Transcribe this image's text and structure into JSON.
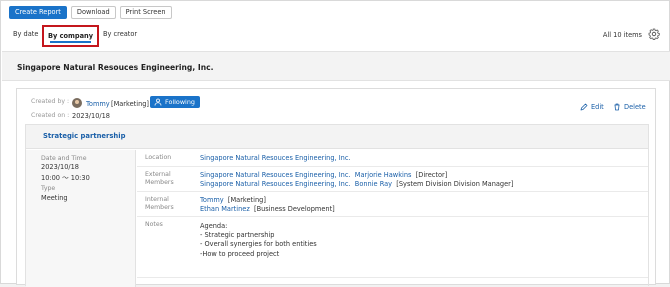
{
  "toolbar": {
    "create_report": "Create Report",
    "download": "Download",
    "print_screen": "Print Screen"
  },
  "tabs": [
    {
      "label": "By date",
      "active": false
    },
    {
      "label": "By company",
      "active": true
    },
    {
      "label": "By creator",
      "active": false
    }
  ],
  "items_count": "All 10 items",
  "company": {
    "name": "Singapore Natural Resouces Engineering, Inc."
  },
  "report": {
    "created_by_label": "Created by :",
    "created_on_label": "Created on :",
    "creator_name": "Tommy",
    "creator_dept": "[Marketing]",
    "follow_label": "Following",
    "created_date": "2023/10/18",
    "edit_label": "Edit",
    "delete_label": "Delete",
    "title": "Strategic partnership",
    "date_time_label": "Date and Time",
    "date": "2023/10/18",
    "time": "10:00 〜 10:30",
    "type_label": "Type",
    "type": "Meeting",
    "location_label": "Location",
    "location": "Singapore Natural Resouces Engineering, Inc.",
    "external_label_1": "External",
    "external_label_2": "Members",
    "external_members": [
      {
        "company": "Singapore Natural Resouces Engineering, Inc.",
        "name": "Marjorie Hawkins",
        "role": "[Director]"
      },
      {
        "company": "Singapore Natural Resouces Engineering, Inc.",
        "name": "Bonnie Ray",
        "role": "[System Division Division Manager]"
      }
    ],
    "internal_label_1": "Internal",
    "internal_label_2": "Members",
    "internal_members": [
      {
        "name": "Tommy",
        "role": "[Marketing]"
      },
      {
        "name": "Ethan Martinez",
        "role": "[Business Development]"
      }
    ],
    "notes_label": "Notes",
    "notes": [
      "Agenda:",
      "- Strategic partnership",
      "- Overall synergies for both entities",
      "-How to proceed project"
    ]
  },
  "colors": {
    "accent": "#1a73c9",
    "highlight_border": "#c4161c",
    "link": "#1a5fa8"
  }
}
